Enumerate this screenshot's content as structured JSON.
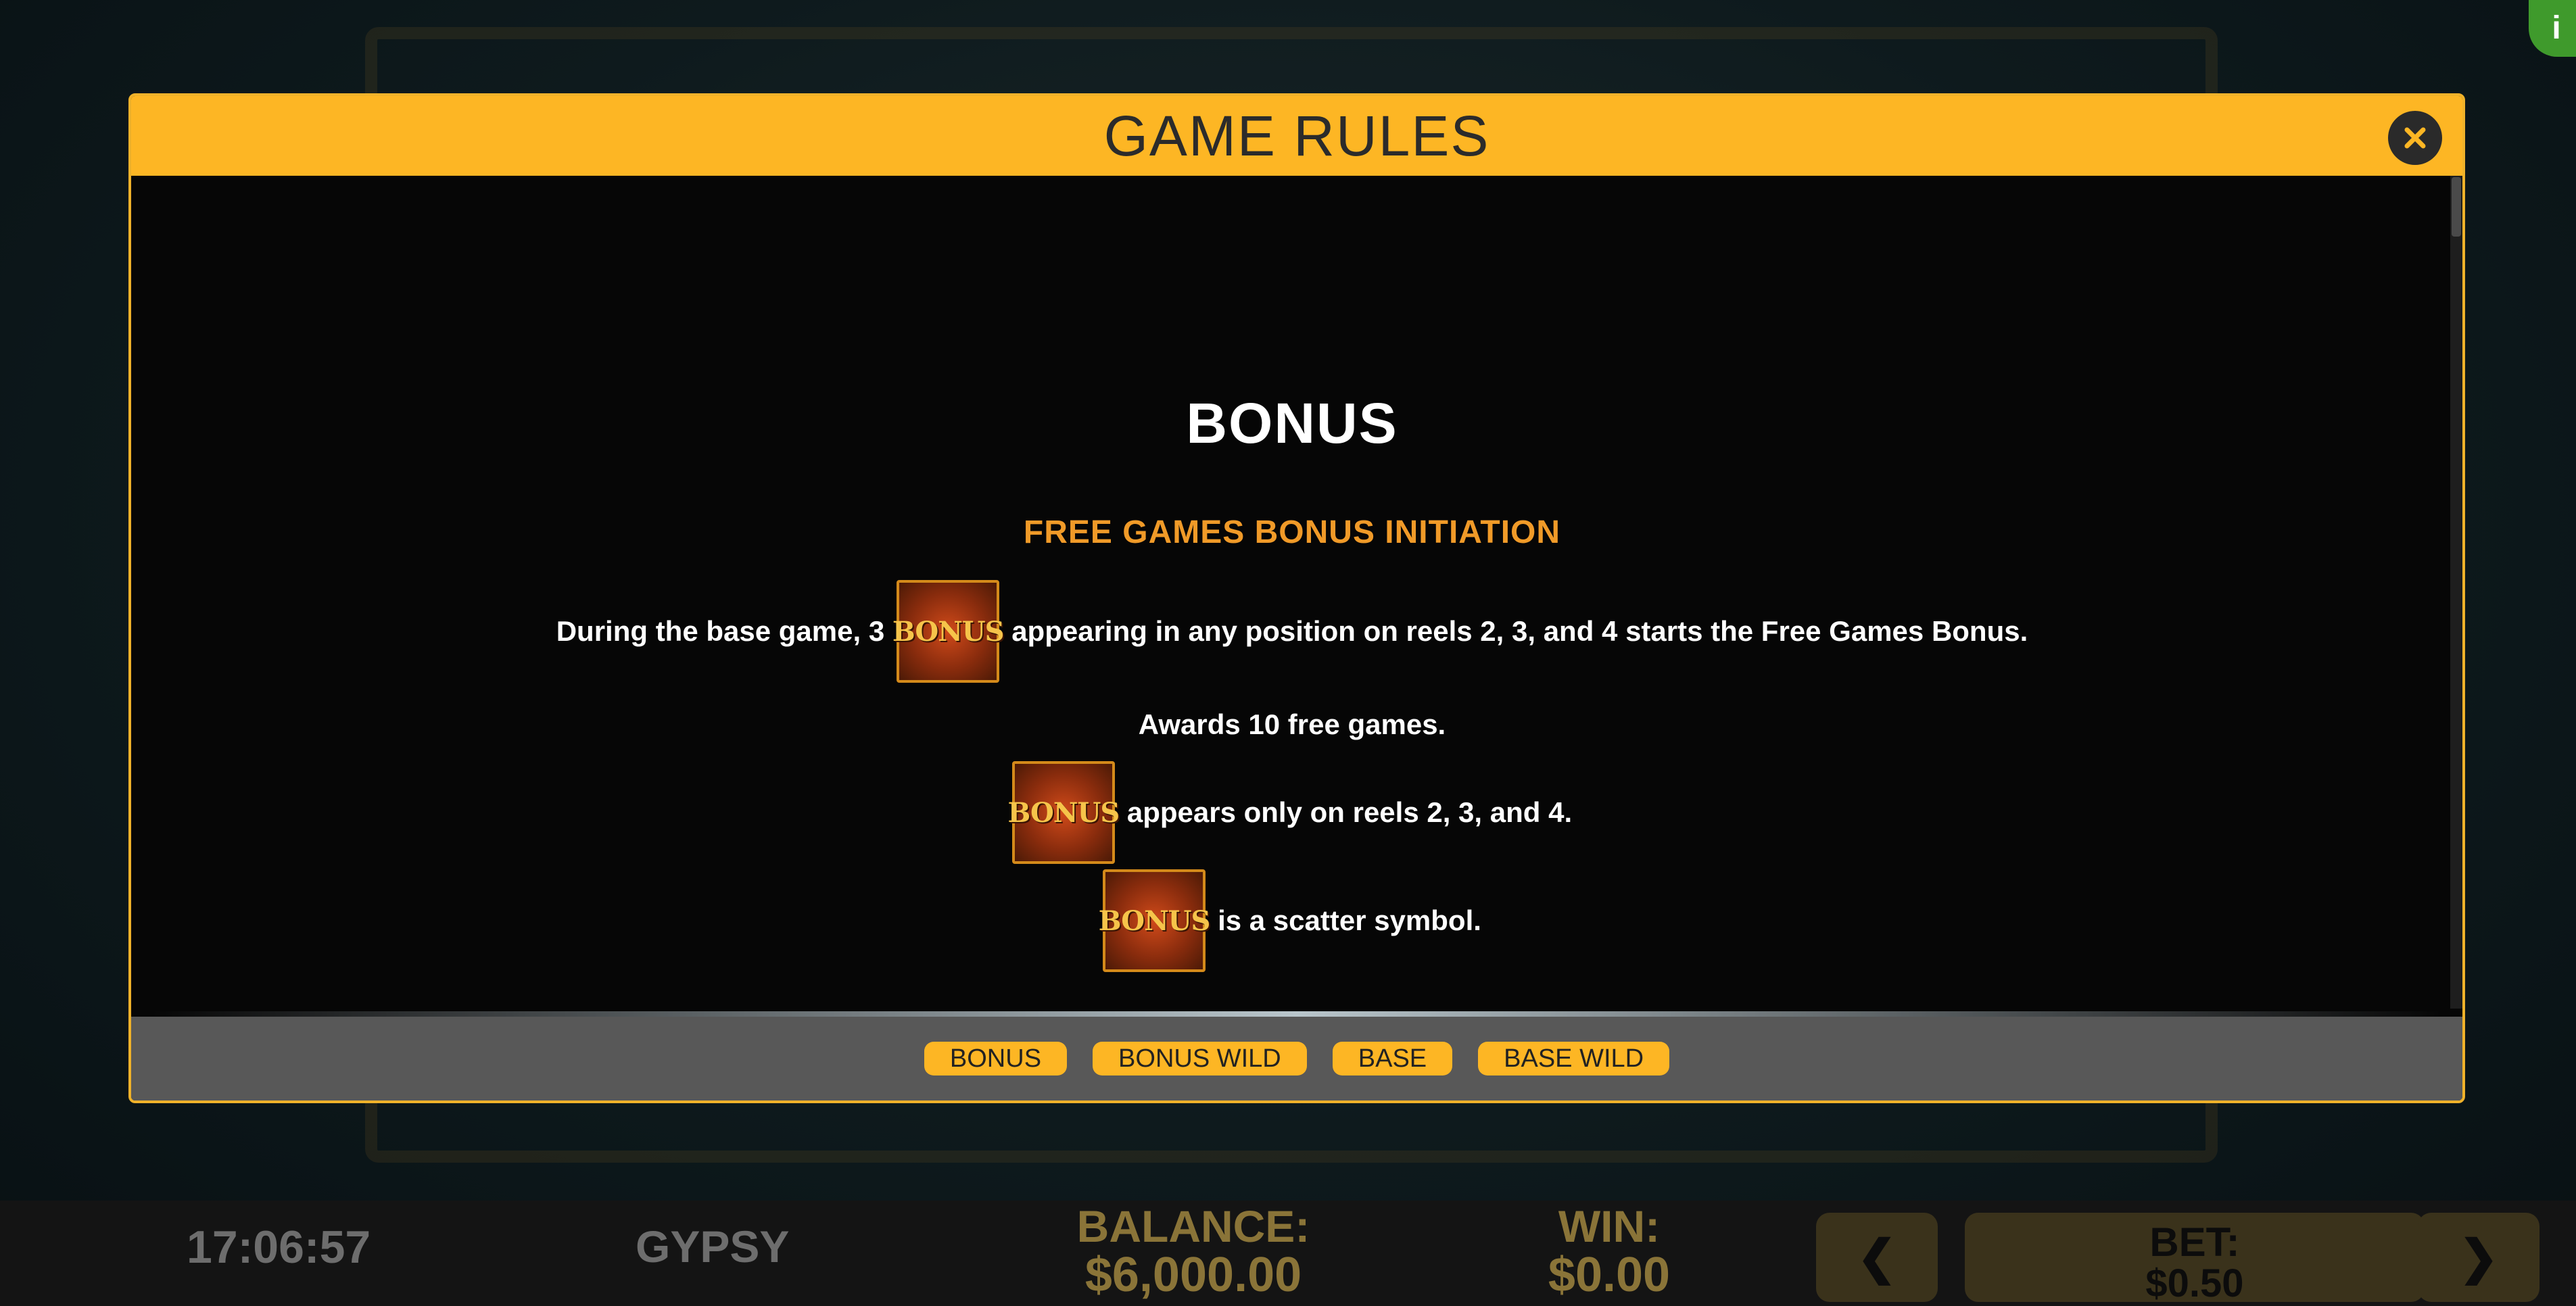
{
  "dialog": {
    "title": "GAME RULES",
    "section_title": "BONUS",
    "subsection_title": "FREE GAMES BONUS INITIATION",
    "para1_before": "During the base game, 3",
    "para1_after": "appearing in any position on reels 2, 3, and 4 starts the Free Games Bonus.",
    "para2": "Awards 10 free games.",
    "para3": "appears only on reels 2, 3, and 4.",
    "para4": "is a scatter symbol.",
    "symbol_label": "BONUS",
    "tabs": [
      "BONUS",
      "BONUS WILD",
      "BASE",
      "BASE WILD"
    ]
  },
  "status_bar": {
    "clock": "17:06:57",
    "game_name": "GYPSY",
    "balance_label": "BALANCE:",
    "balance_value": "$6,000.00",
    "win_label": "WIN:",
    "win_value": "$0.00",
    "bet_label": "BET:",
    "bet_value": "$0.50",
    "prev_glyph": "❮",
    "next_glyph": "❯"
  },
  "info_glyph": "i",
  "colors": {
    "header": "#fdb624",
    "subsection": "#f09a28",
    "status_text": "#8a7438"
  }
}
